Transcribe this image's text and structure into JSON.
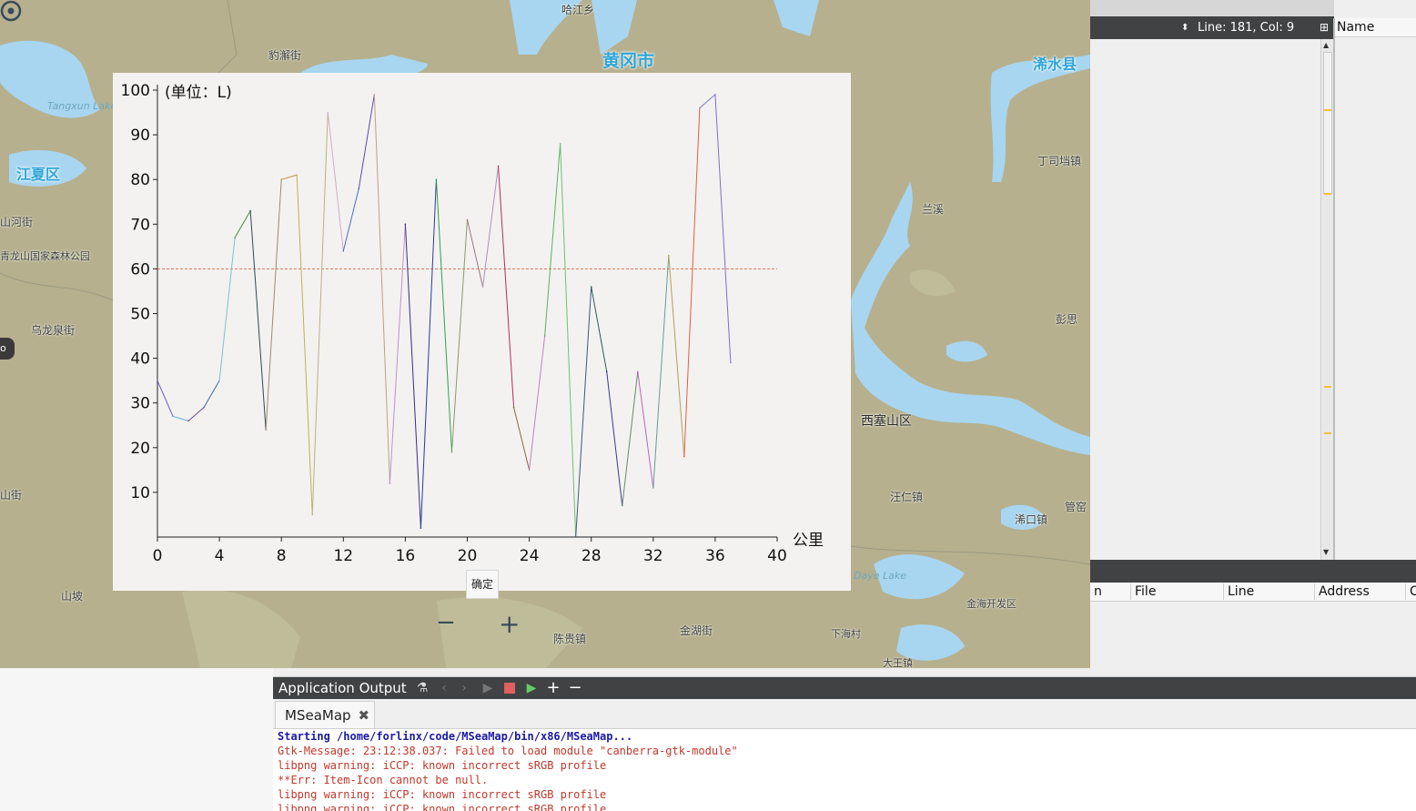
{
  "map": {
    "labels": [
      {
        "text": "哈江乡",
        "style": "small"
      },
      {
        "text": "黄冈市",
        "style": "big"
      },
      {
        "text": "浠水县",
        "style": "mid"
      },
      {
        "text": "豹澥街",
        "style": "small"
      },
      {
        "text": "江夏区",
        "style": "mid"
      },
      {
        "text": "山河街",
        "style": "small"
      },
      {
        "text": "青龙山国家森林公园",
        "style": "small"
      },
      {
        "text": "乌龙泉街",
        "style": "small"
      },
      {
        "text": "山街",
        "style": "small"
      },
      {
        "text": "山坡",
        "style": "small"
      },
      {
        "text": "丁司垱镇",
        "style": "small"
      },
      {
        "text": "兰溪",
        "style": "small"
      },
      {
        "text": "彭思",
        "style": "small"
      },
      {
        "text": "西塞山区",
        "style": "mid-dark"
      },
      {
        "text": "汪仁镇",
        "style": "small"
      },
      {
        "text": "浠口镇",
        "style": "small"
      },
      {
        "text": "管窑",
        "style": "small"
      },
      {
        "text": "金海开发区",
        "style": "small"
      },
      {
        "text": "金湖街",
        "style": "small"
      },
      {
        "text": "陈贵镇",
        "style": "small"
      },
      {
        "text": "下海村",
        "style": "small"
      },
      {
        "text": "大王镇",
        "style": "small"
      },
      {
        "text": "Daye Lake",
        "style": "water"
      },
      {
        "text": "Tangxun Lake",
        "style": "water"
      }
    ],
    "left_pill": "o"
  },
  "chart_data": {
    "type": "line",
    "ylabel": "(单位：L)",
    "xlabel": "公里",
    "xlim": [
      0,
      40
    ],
    "ylim": [
      0,
      100
    ],
    "xticks": [
      0,
      4,
      8,
      12,
      16,
      20,
      24,
      28,
      32,
      36,
      40
    ],
    "yticks": [
      10,
      20,
      30,
      40,
      50,
      60,
      70,
      80,
      90,
      100
    ],
    "reference_line": {
      "y": 60,
      "color": "#e07050"
    },
    "x": [
      0,
      1,
      2,
      3,
      4,
      5,
      6,
      7,
      8,
      9,
      10,
      11,
      12,
      13,
      14,
      15,
      16,
      17,
      18,
      19,
      20,
      21,
      22,
      23,
      24,
      25,
      26,
      27,
      28,
      29,
      30,
      31,
      32,
      33,
      34,
      35,
      36,
      37
    ],
    "y": [
      35,
      27,
      26,
      29,
      35,
      67,
      73,
      24,
      80,
      81,
      5,
      95,
      64,
      78,
      99,
      12,
      70,
      2,
      80,
      19,
      71,
      56,
      83,
      29,
      15,
      45,
      88,
      0,
      56,
      37,
      7,
      37,
      11,
      63,
      18,
      96,
      99,
      39
    ],
    "segment_colors": [
      "#6a5acd",
      "#5fa8d3",
      "#6d4c8a",
      "#3a6aa8",
      "#7ec0d0",
      "#4f8a3c",
      "#2d4a5a",
      "#a08a6a",
      "#c09040",
      "#c0b050",
      "#c0b080",
      "#d8a8c8",
      "#4a6ad0",
      "#5a4ab8",
      "#c0a080",
      "#c090d0",
      "#3a2a8a",
      "#2a3a9a",
      "#30a050",
      "#8a9a6a",
      "#9a7a7a",
      "#b090c0",
      "#b03060",
      "#8a6a3a",
      "#c080c0",
      "#60b060",
      "#70c070",
      "#3a5a7a",
      "#2a5a5a",
      "#3a3a8a",
      "#6a8a6a",
      "#c060c0",
      "#6a9a9a",
      "#b0a050",
      "#e06040",
      "#8080c0",
      "#8070c0"
    ]
  },
  "ok_button": "确定",
  "editor": {
    "line_col": "Line: 181, Col: 9",
    "name_header": "Name"
  },
  "stack_columns": [
    "n",
    "File",
    "Line",
    "Address",
    "C"
  ],
  "app_output": {
    "title": "Application Output",
    "tab_label": "MSeaMap",
    "lines": [
      {
        "text": "Starting /home/forlinx/code/MSeaMap/bin/x86/MSeaMap...",
        "kind": "start"
      },
      {
        "text": "Gtk-Message: 23:12:38.037: Failed to load module \"canberra-gtk-module\"",
        "kind": "err"
      },
      {
        "text": "libpng warning: iCCP: known incorrect sRGB profile",
        "kind": "err"
      },
      {
        "text": "**Err: Item-Icon cannot be null.",
        "kind": "err"
      },
      {
        "text": "libpng warning: iCCP: known incorrect sRGB profile",
        "kind": "err"
      },
      {
        "text": "libpng warning: iCCP: known incorrect sRGB profile",
        "kind": "err"
      }
    ]
  }
}
